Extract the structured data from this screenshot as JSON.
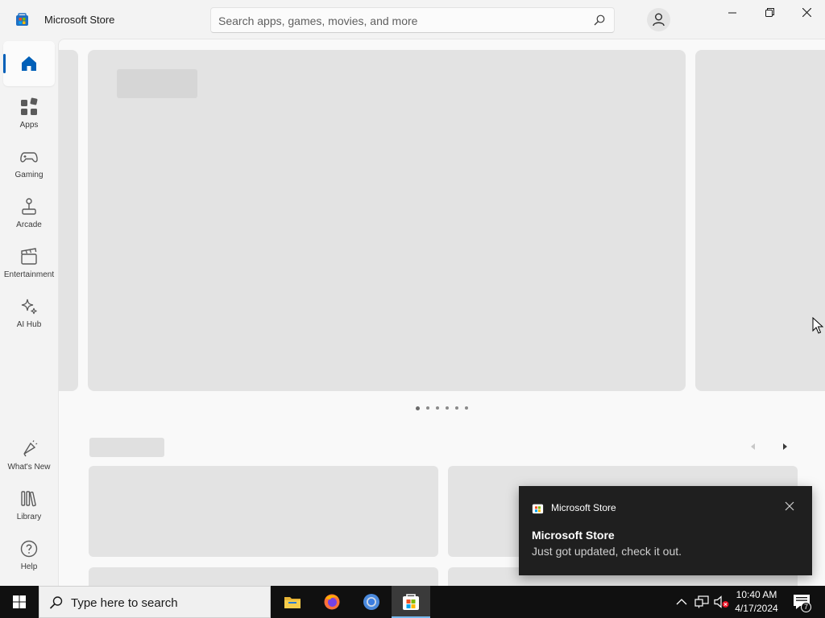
{
  "window": {
    "app_title": "Microsoft Store",
    "accent_color": "#005fb8"
  },
  "search": {
    "placeholder": "Search apps, games, movies, and more",
    "value": ""
  },
  "sidebar": {
    "items": [
      {
        "label": "",
        "icon": "home-icon",
        "active": true
      },
      {
        "label": "Apps",
        "icon": "apps-icon"
      },
      {
        "label": "Gaming",
        "icon": "gamepad-icon"
      },
      {
        "label": "Arcade",
        "icon": "joystick-icon"
      },
      {
        "label": "Entertainment",
        "icon": "clapperboard-icon"
      },
      {
        "label": "AI Hub",
        "icon": "sparkle-icon"
      }
    ],
    "bottom_items": [
      {
        "label": "What's New",
        "icon": "megaphone-icon"
      },
      {
        "label": "Library",
        "icon": "library-icon"
      },
      {
        "label": "Help",
        "icon": "help-icon"
      }
    ]
  },
  "carousel": {
    "slide_count": 6,
    "active_index": 0
  },
  "toast": {
    "app_name": "Microsoft Store",
    "title": "Microsoft Store",
    "body": "Just got updated, check it out."
  },
  "taskbar": {
    "search_placeholder": "Type here to search",
    "apps": [
      "file-explorer-icon",
      "firefox-icon",
      "chrome-icon",
      "microsoft-store-icon"
    ],
    "time": "10:40 AM",
    "date": "4/17/2024",
    "notification_count": "7"
  }
}
